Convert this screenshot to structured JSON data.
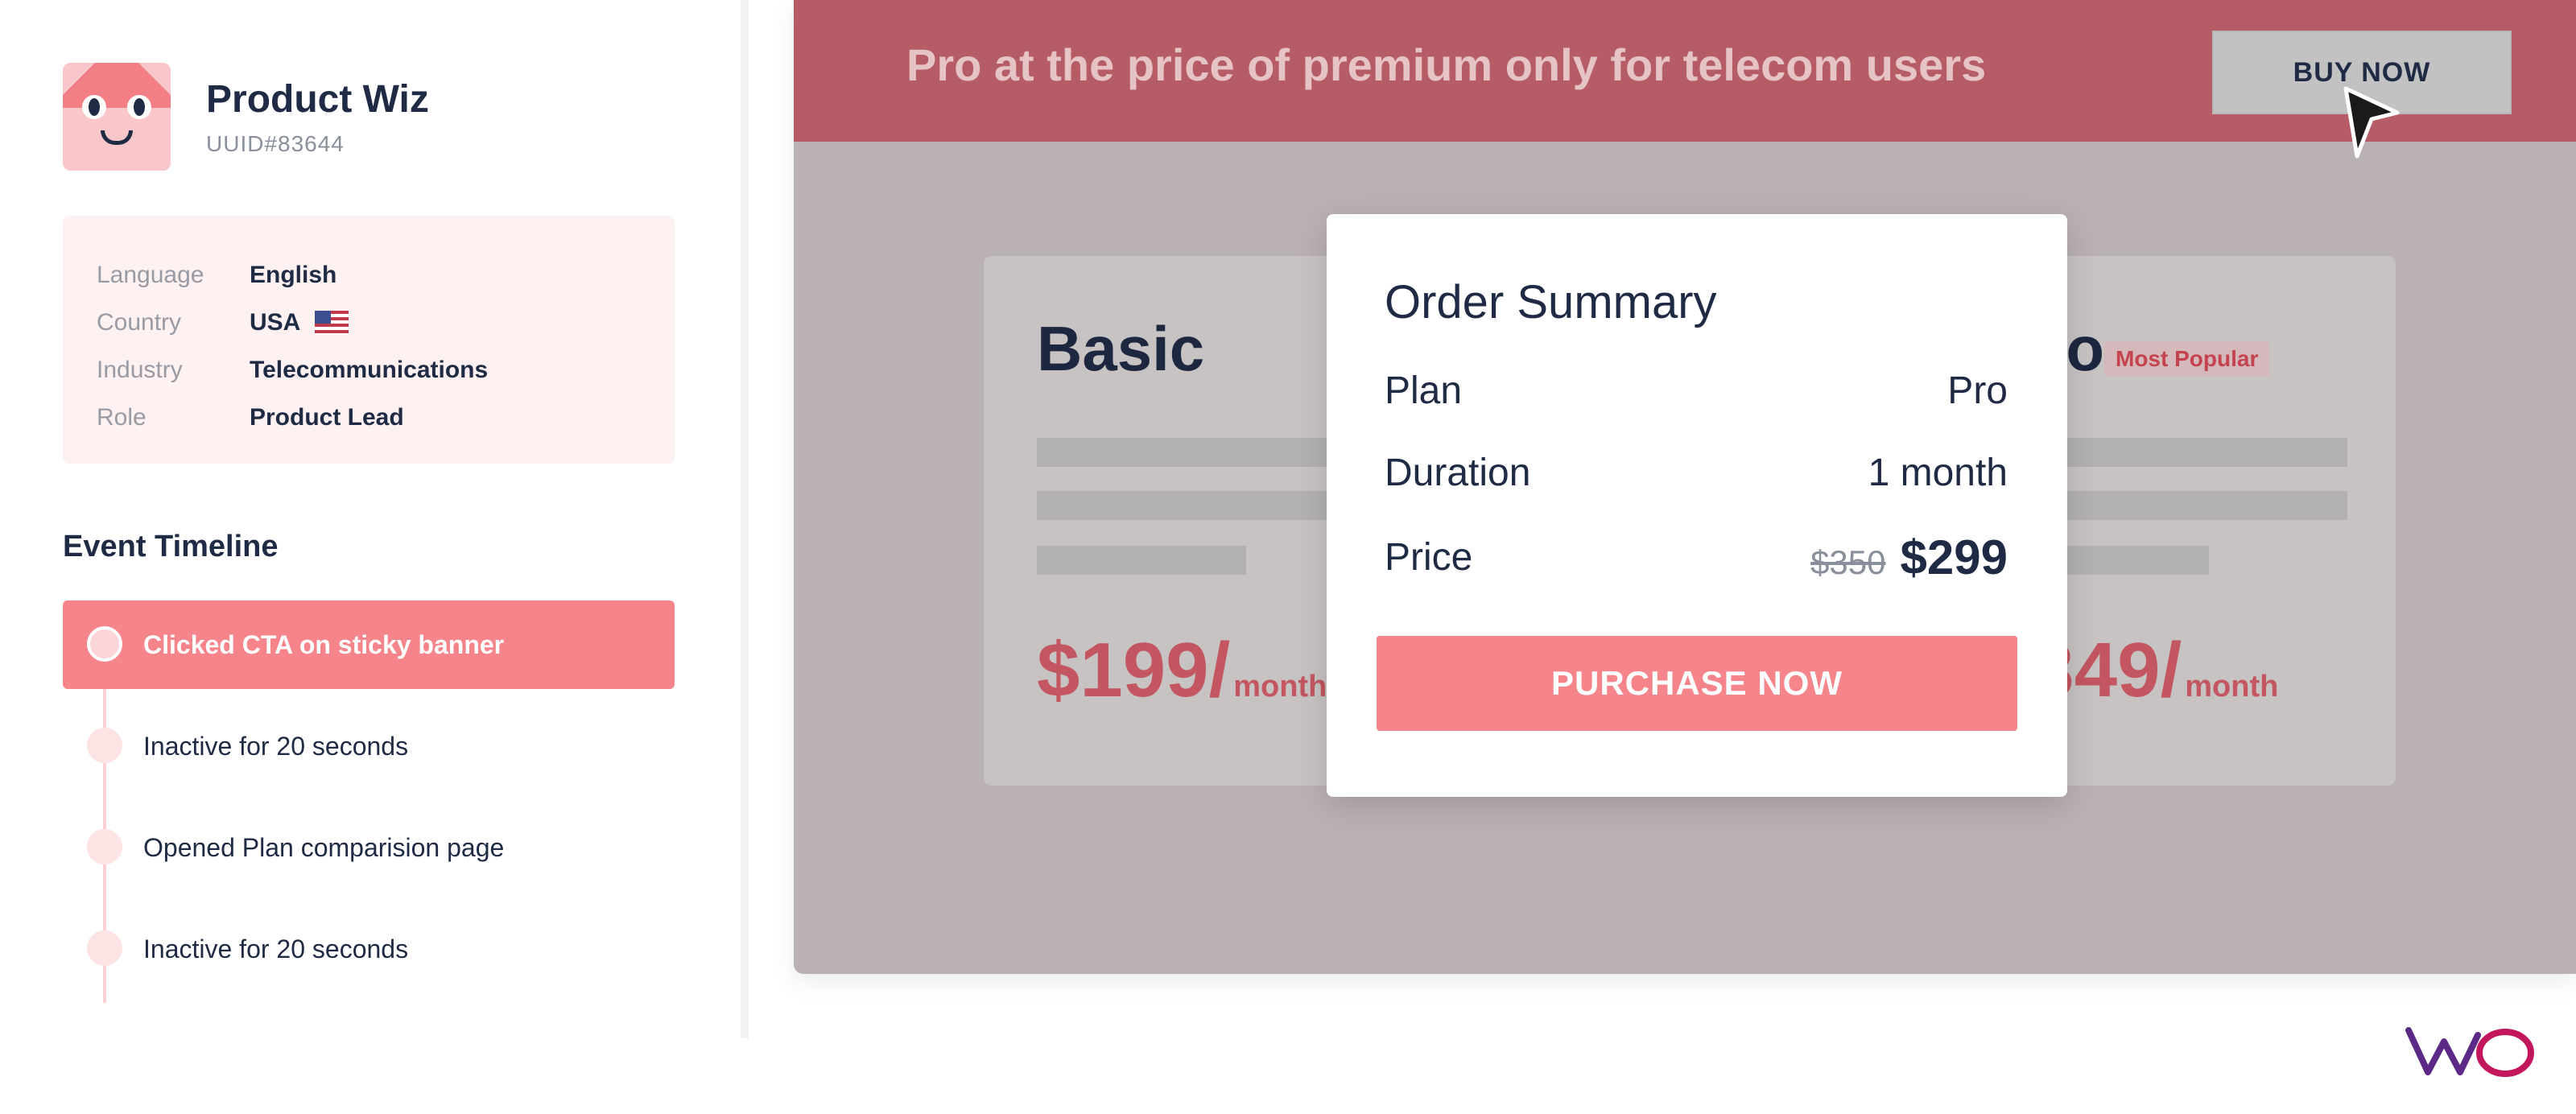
{
  "profile": {
    "name": "Product Wiz",
    "uuid": "UUID#83644",
    "avatar_icon": "cat-avatar-icon"
  },
  "info": [
    {
      "label": "Language",
      "value": "English"
    },
    {
      "label": "Country",
      "value": "USA",
      "icon": "us-flag-icon"
    },
    {
      "label": "Industry",
      "value": "Telecommunications"
    },
    {
      "label": "Role",
      "value": "Product Lead"
    }
  ],
  "timeline": {
    "title": "Event Timeline",
    "events": [
      {
        "label": "Clicked CTA on sticky banner",
        "active": true
      },
      {
        "label": "Inactive for 20 seconds",
        "active": false
      },
      {
        "label": "Opened Plan comparision page",
        "active": false
      },
      {
        "label": "Inactive for 20 seconds",
        "active": false
      }
    ]
  },
  "banner": {
    "text": "Pro at the price of premium only for telecom users",
    "button": "BUY NOW"
  },
  "plans": {
    "basic": {
      "title": "Basic",
      "price": "$199/",
      "unit": "month"
    },
    "pro": {
      "title": "Pro",
      "badge": "Most Popular",
      "price": "$349/",
      "unit": "month"
    }
  },
  "order_summary": {
    "title": "Order Summary",
    "plan_label": "Plan",
    "plan_value": "Pro",
    "duration_label": "Duration",
    "duration_value": "1 month",
    "price_label": "Price",
    "price_old": "$350",
    "price_new": "$299",
    "button": "PURCHASE NOW"
  },
  "brand": {
    "logo": "VWO",
    "colors": {
      "accent": "#f5848b",
      "banner": "#b55c66",
      "text_dark": "#1f2a44"
    }
  }
}
